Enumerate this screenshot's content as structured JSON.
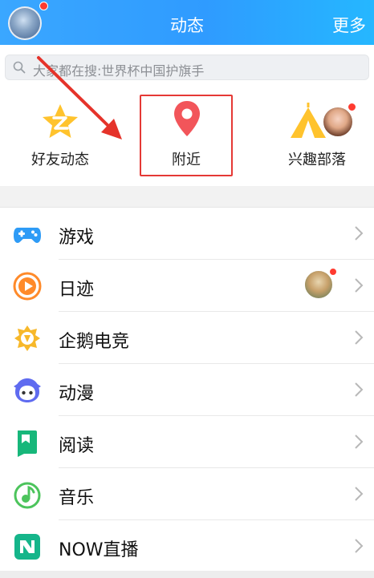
{
  "header": {
    "title": "动态",
    "more_label": "更多"
  },
  "search": {
    "placeholder": "大家都在搜:世界杯中国护旗手"
  },
  "quick_actions": [
    {
      "label": "好友动态",
      "icon": "star-z-icon"
    },
    {
      "label": "附近",
      "icon": "location-pin-icon"
    },
    {
      "label": "兴趣部落",
      "icon": "tent-icon"
    }
  ],
  "list": [
    {
      "label": "游戏",
      "icon": "gamepad-icon"
    },
    {
      "label": "日迹",
      "icon": "diary-play-icon"
    },
    {
      "label": "企鹅电竞",
      "icon": "esports-crest-icon"
    },
    {
      "label": "动漫",
      "icon": "anime-mascot-icon"
    },
    {
      "label": "阅读",
      "icon": "bookmark-icon"
    },
    {
      "label": "音乐",
      "icon": "music-note-icon"
    },
    {
      "label": "NOW直播",
      "icon": "now-live-icon"
    }
  ],
  "colors": {
    "header_blue": "#2f9bff",
    "highlight_red": "#e53935",
    "badge_red": "#ff3b30"
  }
}
